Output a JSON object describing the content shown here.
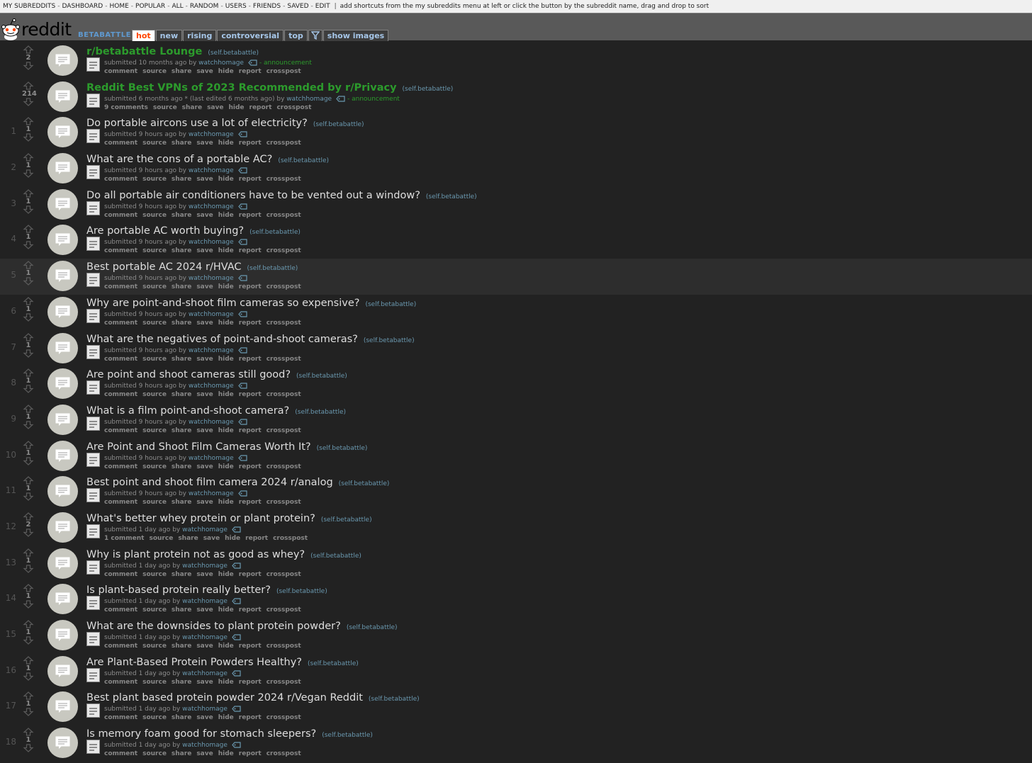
{
  "top_bar": {
    "links": [
      "MY SUBREDDITS",
      "DASHBOARD",
      "HOME",
      "POPULAR",
      "ALL",
      "RANDOM",
      "USERS",
      "FRIENDS",
      "SAVED",
      "EDIT"
    ],
    "hint": "add shortcuts from the my subreddits menu at left or click the button by the subreddit name, drag and drop to sort"
  },
  "header": {
    "logo_text": "reddit",
    "subreddit_name": "BETABATTLE",
    "tabs": [
      "hot",
      "new",
      "rising",
      "controversial",
      "top"
    ],
    "selected_tab": "hot",
    "filter_icon": "filter-icon",
    "show_images_label": "show images"
  },
  "colors": {
    "background": "#222222",
    "stickied_title": "#2c9b2c",
    "link": "#6a98af",
    "selected_tab_text": "#ff4500"
  },
  "posts": [
    {
      "rank": "",
      "score": "2",
      "title": "r/betabattle Lounge",
      "domain": "(self.betabattle)",
      "time": "10 months ago",
      "edited": "",
      "author": "watchhomage",
      "flair": "announcement",
      "comments": "comment",
      "stickied": true
    },
    {
      "rank": "",
      "score": "214",
      "title": "Reddit Best VPNs of 2023 Recommended by r/Privacy",
      "domain": "(self.betabattle)",
      "time": "6 months ago",
      "edited": "* (last edited 6 months ago)",
      "author": "watchhomage",
      "flair": "announcement",
      "comments": "9 comments",
      "stickied": true
    },
    {
      "rank": "1",
      "score": "1",
      "title": "Do portable aircons use a lot of electricity?",
      "domain": "(self.betabattle)",
      "time": "9 hours ago",
      "edited": "",
      "author": "watchhomage",
      "flair": "",
      "comments": "comment",
      "stickied": false
    },
    {
      "rank": "2",
      "score": "1",
      "title": "What are the cons of a portable AC?",
      "domain": "(self.betabattle)",
      "time": "9 hours ago",
      "edited": "",
      "author": "watchhomage",
      "flair": "",
      "comments": "comment",
      "stickied": false
    },
    {
      "rank": "3",
      "score": "1",
      "title": "Do all portable air conditioners have to be vented out a window?",
      "domain": "(self.betabattle)",
      "time": "9 hours ago",
      "edited": "",
      "author": "watchhomage",
      "flair": "",
      "comments": "comment",
      "stickied": false
    },
    {
      "rank": "4",
      "score": "1",
      "title": "Are portable AC worth buying?",
      "domain": "(self.betabattle)",
      "time": "9 hours ago",
      "edited": "",
      "author": "watchhomage",
      "flair": "",
      "comments": "comment",
      "stickied": false
    },
    {
      "rank": "5",
      "score": "1",
      "title": "Best portable AC 2024 r/HVAC",
      "domain": "(self.betabattle)",
      "time": "9 hours ago",
      "edited": "",
      "author": "watchhomage",
      "flair": "",
      "comments": "comment",
      "stickied": false,
      "highlight": true
    },
    {
      "rank": "6",
      "score": "1",
      "title": "Why are point-and-shoot film cameras so expensive?",
      "domain": "(self.betabattle)",
      "time": "9 hours ago",
      "edited": "",
      "author": "watchhomage",
      "flair": "",
      "comments": "comment",
      "stickied": false
    },
    {
      "rank": "7",
      "score": "1",
      "title": "What are the negatives of point-and-shoot cameras?",
      "domain": "(self.betabattle)",
      "time": "9 hours ago",
      "edited": "",
      "author": "watchhomage",
      "flair": "",
      "comments": "comment",
      "stickied": false
    },
    {
      "rank": "8",
      "score": "1",
      "title": "Are point and shoot cameras still good?",
      "domain": "(self.betabattle)",
      "time": "9 hours ago",
      "edited": "",
      "author": "watchhomage",
      "flair": "",
      "comments": "comment",
      "stickied": false
    },
    {
      "rank": "9",
      "score": "1",
      "title": "What is a film point-and-shoot camera?",
      "domain": "(self.betabattle)",
      "time": "9 hours ago",
      "edited": "",
      "author": "watchhomage",
      "flair": "",
      "comments": "comment",
      "stickied": false
    },
    {
      "rank": "10",
      "score": "1",
      "title": "Are Point and Shoot Film Cameras Worth It?",
      "domain": "(self.betabattle)",
      "time": "9 hours ago",
      "edited": "",
      "author": "watchhomage",
      "flair": "",
      "comments": "comment",
      "stickied": false
    },
    {
      "rank": "11",
      "score": "1",
      "title": "Best point and shoot film camera 2024 r/analog",
      "domain": "(self.betabattle)",
      "time": "9 hours ago",
      "edited": "",
      "author": "watchhomage",
      "flair": "",
      "comments": "comment",
      "stickied": false
    },
    {
      "rank": "12",
      "score": "2",
      "title": "What's better whey protein or plant protein?",
      "domain": "(self.betabattle)",
      "time": "1 day ago",
      "edited": "",
      "author": "watchhomage",
      "flair": "",
      "comments": "1 comment",
      "stickied": false
    },
    {
      "rank": "13",
      "score": "1",
      "title": "Why is plant protein not as good as whey?",
      "domain": "(self.betabattle)",
      "time": "1 day ago",
      "edited": "",
      "author": "watchhomage",
      "flair": "",
      "comments": "comment",
      "stickied": false
    },
    {
      "rank": "14",
      "score": "1",
      "title": "Is plant-based protein really better?",
      "domain": "(self.betabattle)",
      "time": "1 day ago",
      "edited": "",
      "author": "watchhomage",
      "flair": "",
      "comments": "comment",
      "stickied": false
    },
    {
      "rank": "15",
      "score": "1",
      "title": "What are the downsides to plant protein powder?",
      "domain": "(self.betabattle)",
      "time": "1 day ago",
      "edited": "",
      "author": "watchhomage",
      "flair": "",
      "comments": "comment",
      "stickied": false
    },
    {
      "rank": "16",
      "score": "1",
      "title": "Are Plant-Based Protein Powders Healthy?",
      "domain": "(self.betabattle)",
      "time": "1 day ago",
      "edited": "",
      "author": "watchhomage",
      "flair": "",
      "comments": "comment",
      "stickied": false
    },
    {
      "rank": "17",
      "score": "1",
      "title": "Best plant based protein powder 2024 r/Vegan Reddit",
      "domain": "(self.betabattle)",
      "time": "1 day ago",
      "edited": "",
      "author": "watchhomage",
      "flair": "",
      "comments": "comment",
      "stickied": false
    },
    {
      "rank": "18",
      "score": "1",
      "title": "Is memory foam good for stomach sleepers?",
      "domain": "(self.betabattle)",
      "time": "1 day ago",
      "edited": "",
      "author": "watchhomage",
      "flair": "",
      "comments": "comment",
      "stickied": false
    }
  ],
  "strings": {
    "submitted": "submitted",
    "by": "by",
    "flair_dash": "-",
    "source": "source",
    "share": "share",
    "save": "save",
    "hide": "hide",
    "report": "report",
    "crosspost": "crosspost"
  }
}
